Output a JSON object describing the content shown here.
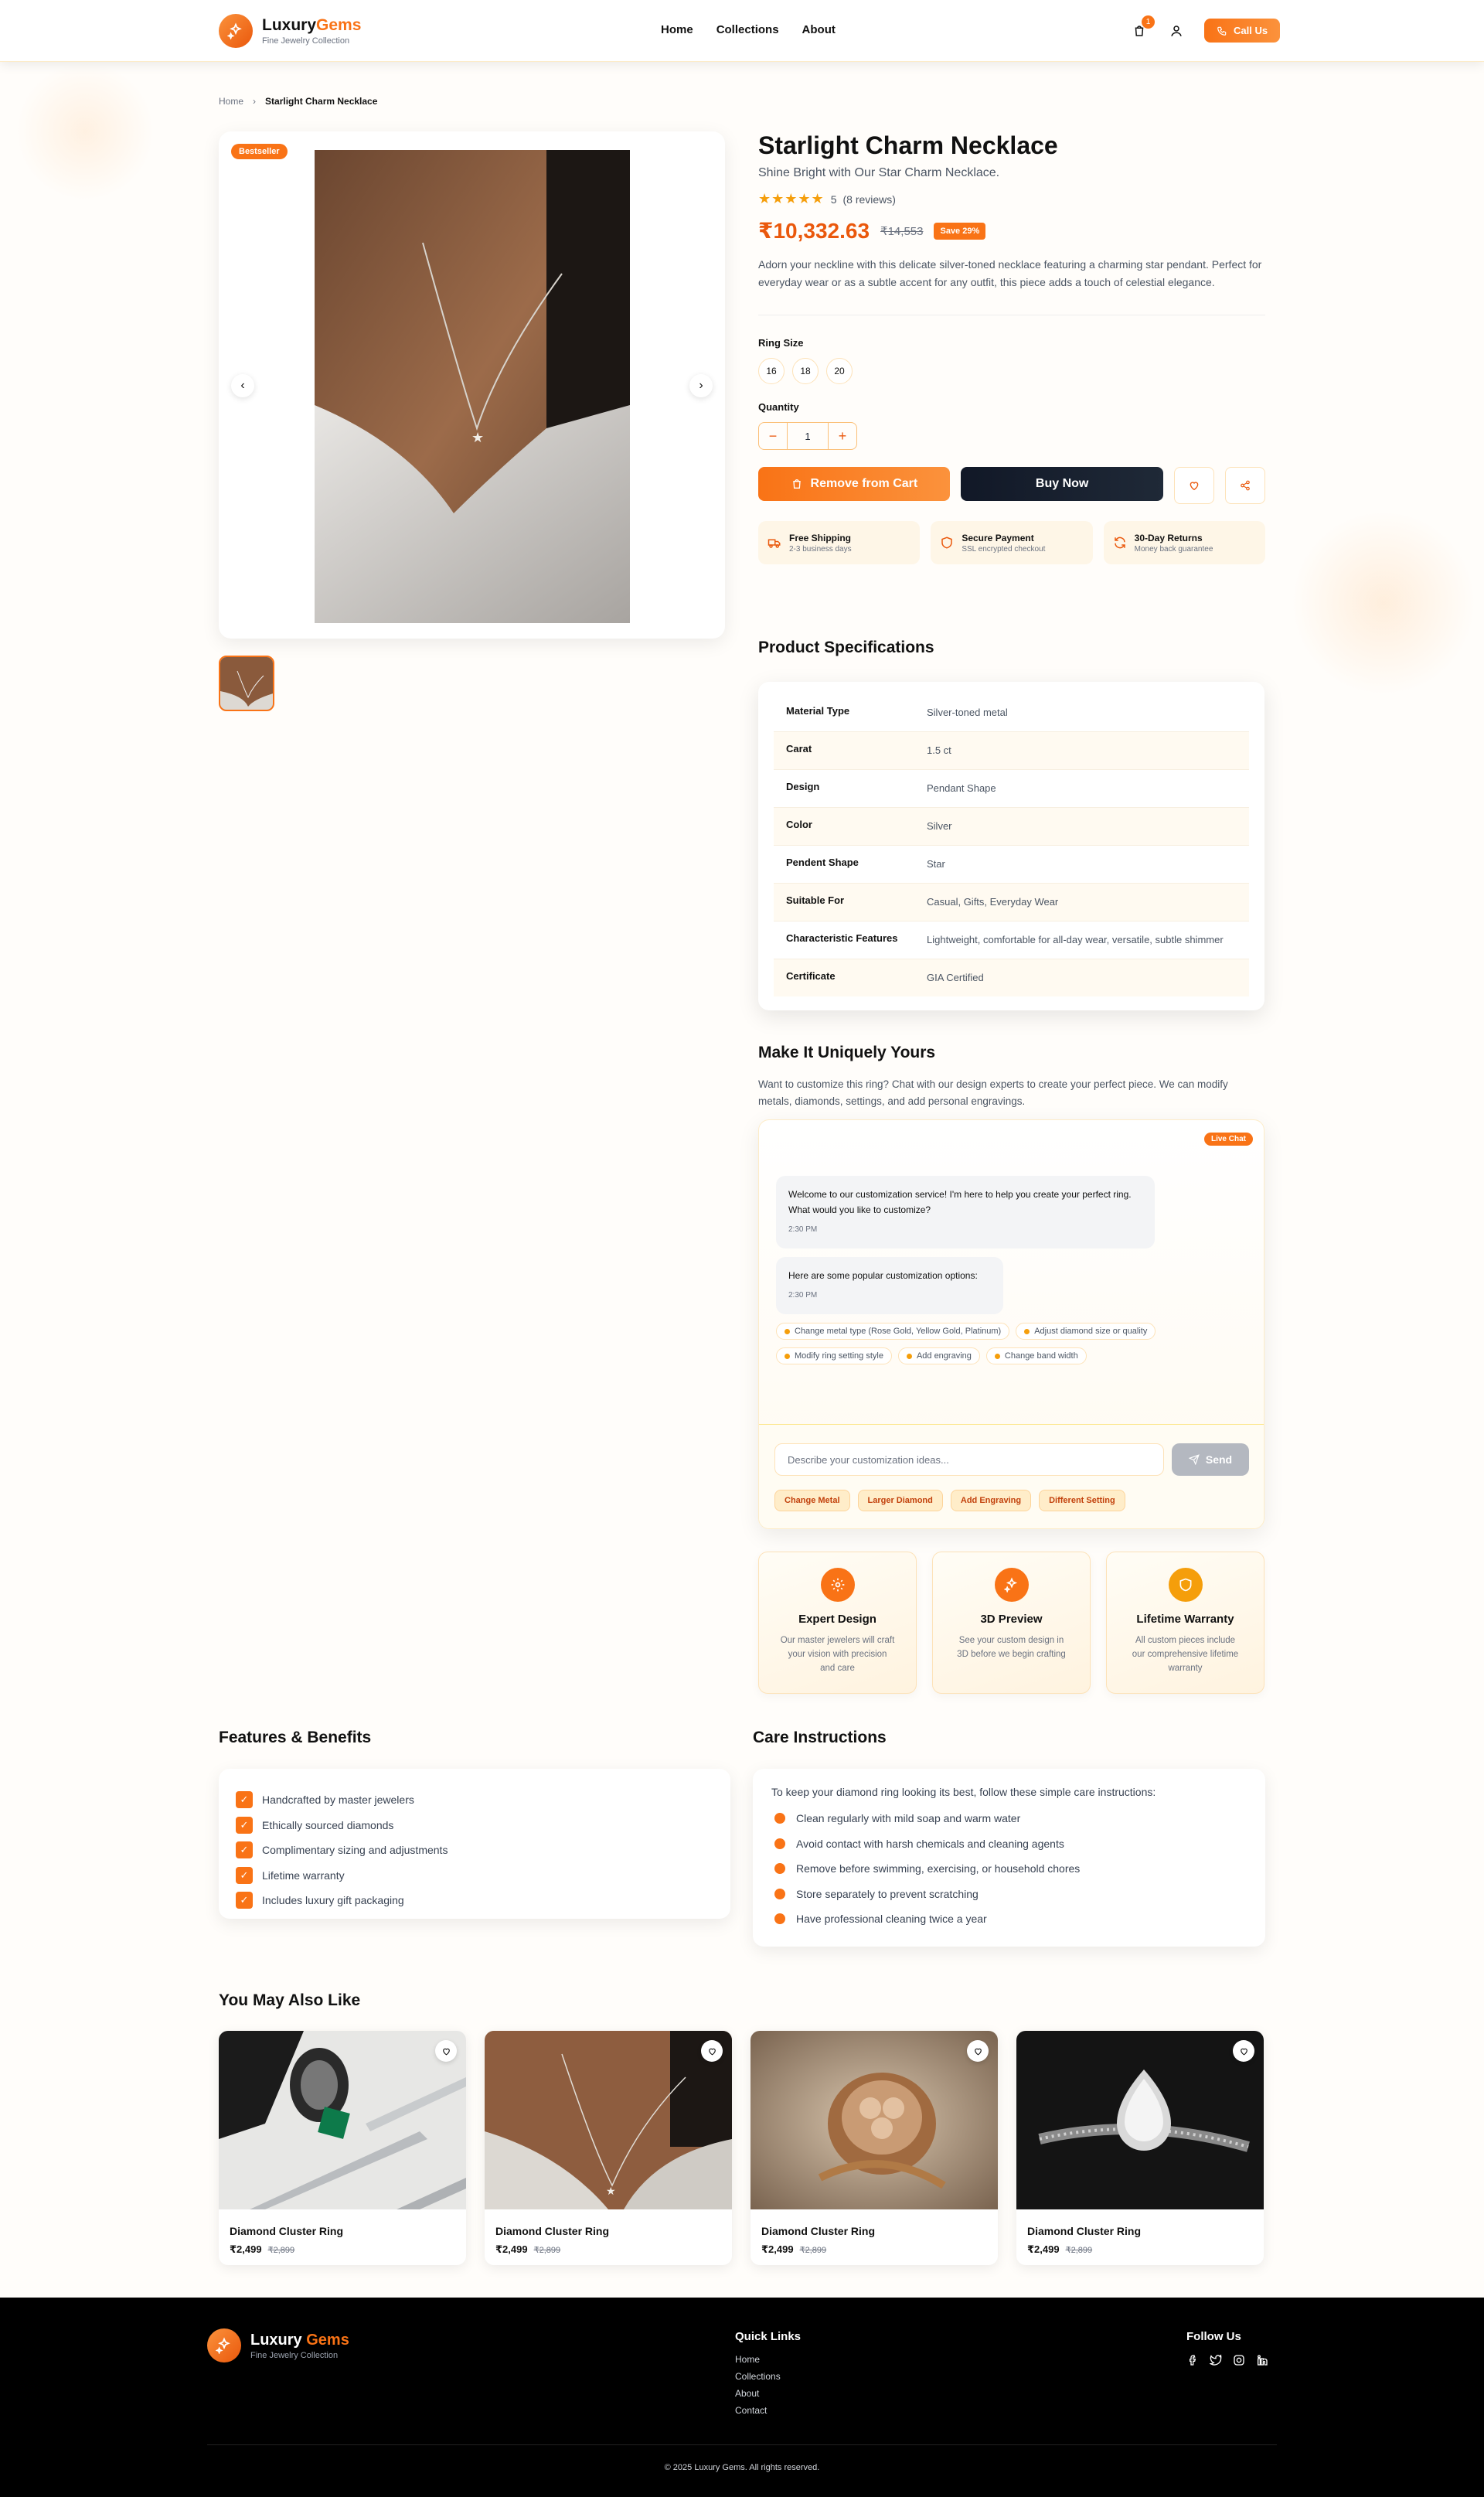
{
  "header": {
    "brand_main": "Luxury",
    "brand_accent": "Gems",
    "tagline": "Fine Jewelry Collection",
    "nav": [
      "Home",
      "Collections",
      "About"
    ],
    "cart_count": "1",
    "call_label": "Call Us"
  },
  "breadcrumb": {
    "home": "Home",
    "current": "Starlight Charm Necklace"
  },
  "gallery": {
    "badge": "Bestseller"
  },
  "product": {
    "title": "Starlight Charm Necklace",
    "subtitle": "Shine Bright with Our Star Charm Necklace.",
    "rating": "5",
    "reviews": "(8 reviews)",
    "price": "₹10,332.63",
    "old_price": "₹14,553",
    "save": "Save 29%",
    "description": "Adorn your neckline with this delicate silver-toned necklace featuring a charming star pendant. Perfect for everyday wear or as a subtle accent for any outfit, this piece adds a touch of celestial elegance.",
    "size_label": "Ring Size",
    "sizes": [
      "16",
      "18",
      "20"
    ],
    "qty_label": "Quantity",
    "qty": "1",
    "remove_label": "Remove from Cart",
    "buy_label": "Buy Now"
  },
  "perks": [
    {
      "title": "Free Shipping",
      "sub": "2-3 business days"
    },
    {
      "title": "Secure Payment",
      "sub": "SSL encrypted checkout"
    },
    {
      "title": "30-Day Returns",
      "sub": "Money back guarantee"
    }
  ],
  "specs": {
    "title": "Product Specifications",
    "rows": [
      {
        "k": "Material Type",
        "v": "Silver-toned metal"
      },
      {
        "k": "Carat",
        "v": "1.5 ct"
      },
      {
        "k": "Design",
        "v": "Pendant Shape"
      },
      {
        "k": "Color",
        "v": "Silver"
      },
      {
        "k": "Pendent Shape",
        "v": "Star"
      },
      {
        "k": "Suitable For",
        "v": "Casual, Gifts, Everyday Wear"
      },
      {
        "k": "Characteristic Features",
        "v": "Lightweight, comfortable for all-day wear, versatile, subtle shimmer"
      },
      {
        "k": "Certificate",
        "v": "GIA Certified"
      }
    ]
  },
  "customize": {
    "title": "Make It Uniquely Yours",
    "desc": "Want to customize this ring? Chat with our design experts to create your perfect piece. We can modify metals, diamonds, settings, and add personal engravings.",
    "live": "Live Chat",
    "msg1": "Welcome to our customization service! I'm here to help you create your perfect ring. What would you like to customize?",
    "msg1_time": "2:30 PM",
    "msg2": "Here are some popular customization options:",
    "msg2_time": "2:30 PM",
    "chips": [
      "Change metal type (Rose Gold, Yellow Gold, Platinum)",
      "Adjust diamond size or quality",
      "Modify ring setting style",
      "Add engraving",
      "Change band width"
    ],
    "placeholder": "Describe your customization ideas...",
    "send": "Send",
    "quick": [
      "Change Metal",
      "Larger Diamond",
      "Add Engraving",
      "Different Setting"
    ]
  },
  "custom_cards": [
    {
      "title": "Expert Design",
      "desc": "Our master jewelers will craft your vision with precision and care",
      "icon": "gear-icon"
    },
    {
      "title": "3D Preview",
      "desc": "See your custom design in 3D before we begin crafting",
      "icon": "sparkle-icon"
    },
    {
      "title": "Lifetime Warranty",
      "desc": "All custom pieces include our comprehensive lifetime warranty",
      "icon": "shield-icon"
    }
  ],
  "features": {
    "title": "Features & Benefits",
    "items": [
      "Handcrafted by master jewelers",
      "Ethically sourced diamonds",
      "Complimentary sizing and adjustments",
      "Lifetime warranty",
      "Includes luxury gift packaging"
    ]
  },
  "care": {
    "title": "Care Instructions",
    "intro": "To keep your diamond ring looking its best, follow these simple care instructions:",
    "items": [
      "Clean regularly with mild soap and warm water",
      "Avoid contact with harsh chemicals and cleaning agents",
      "Remove before swimming, exercising, or household chores",
      "Store separately to prevent scratching",
      "Have professional cleaning twice a year"
    ]
  },
  "related": {
    "title": "You May Also Like",
    "items": [
      {
        "name": "Diamond Cluster Ring",
        "price": "₹2,499",
        "old": "₹2,899"
      },
      {
        "name": "Diamond Cluster Ring",
        "price": "₹2,499",
        "old": "₹2,899"
      },
      {
        "name": "Diamond Cluster Ring",
        "price": "₹2,499",
        "old": "₹2,899"
      },
      {
        "name": "Diamond Cluster Ring",
        "price": "₹2,499",
        "old": "₹2,899"
      }
    ]
  },
  "footer": {
    "brand_main": "Luxury",
    "brand_accent": "Gems",
    "tagline": "Fine Jewelry Collection",
    "links_title": "Quick Links",
    "links": [
      "Home",
      "Collections",
      "About",
      "Contact"
    ],
    "follow_title": "Follow Us",
    "copyright": "© 2025 Luxury Gems. All rights reserved."
  },
  "colors": {
    "accent": "#f97316",
    "accent_dark": "#ea580c",
    "dark": "#111827"
  }
}
